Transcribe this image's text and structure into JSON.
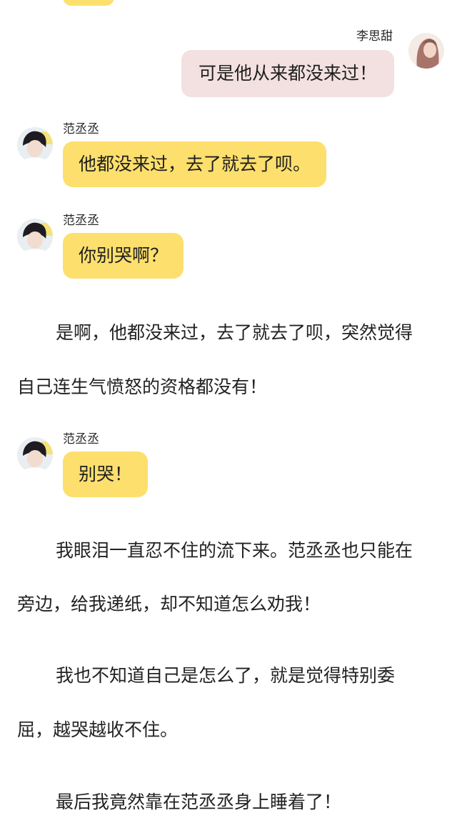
{
  "messages": [
    {
      "sender": "李思甜",
      "text": "可是他从来都没来过！",
      "side": "right"
    },
    {
      "sender": "范丞丞",
      "text": "他都没来过，去了就去了呗。",
      "side": "left"
    },
    {
      "sender": "范丞丞",
      "text": "你别哭啊？",
      "side": "left"
    },
    {
      "sender": "范丞丞",
      "text": "别哭！",
      "side": "left"
    }
  ],
  "narration": [
    [
      "是啊，他都没来过，去了就去了呗，突然觉得",
      "自己连生气愤怒的资格都没有！"
    ],
    [
      "我眼泪一直忍不住的流下来。范丞丞也只能在",
      "旁边，给我递纸，却不知道怎么劝我！"
    ],
    [
      "我也不知道自己是怎么了，就是觉得特别委",
      "屈，越哭越收不住。"
    ],
    [
      "最后我竟然靠在范丞丞身上睡着了！"
    ]
  ],
  "colors": {
    "left_bubble": "#fddf6d",
    "right_bubble": "#f3e0e0",
    "background": "#ffffff"
  },
  "icons": {
    "left_avatar": "boy-avatar-icon",
    "right_avatar": "girl-avatar-icon"
  }
}
